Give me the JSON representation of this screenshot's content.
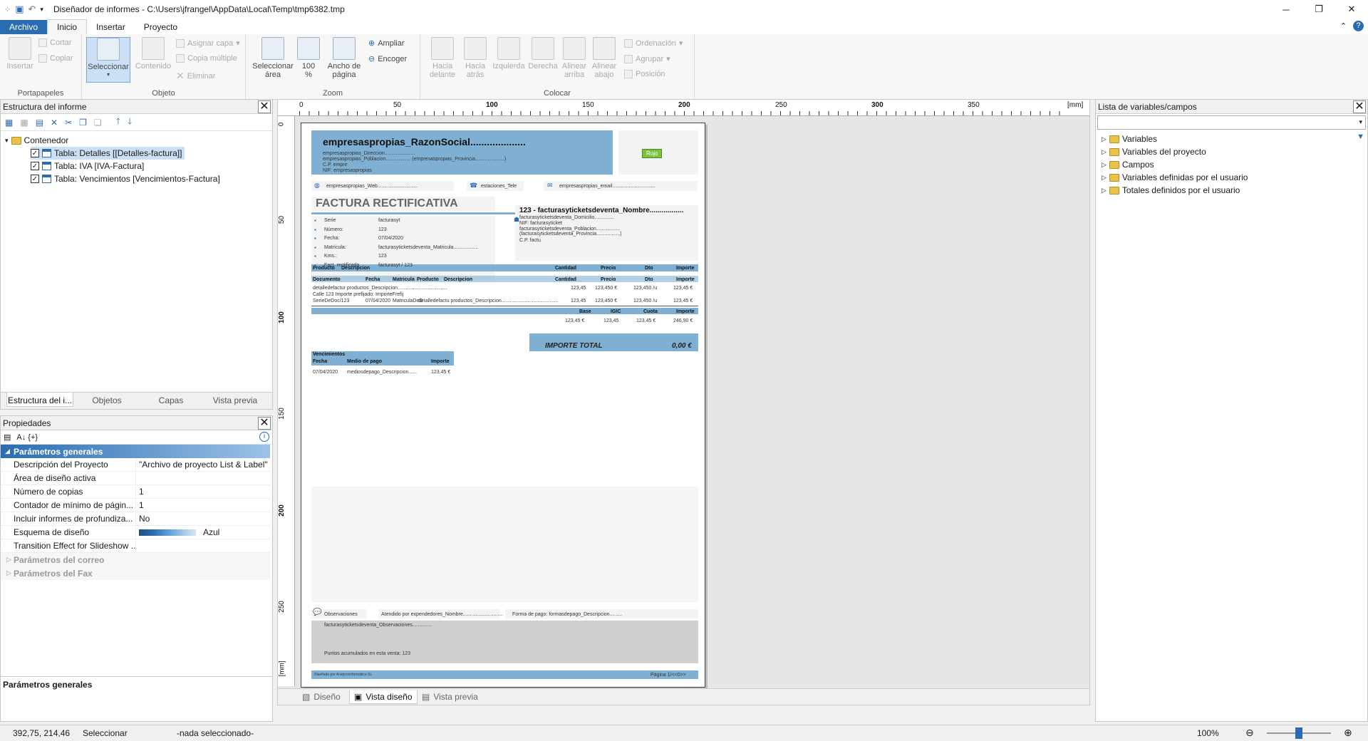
{
  "window": {
    "title": "Diseñador de informes - C:\\Users\\jfrangel\\AppData\\Local\\Temp\\tmp6382.tmp"
  },
  "ribbon_tabs": [
    "Archivo",
    "Inicio",
    "Insertar",
    "Proyecto"
  ],
  "ribbon": {
    "portapapeles": {
      "label": "Portapapeles",
      "insertar": "Insertar",
      "cortar": "Cortar",
      "copiar": "Copiar"
    },
    "objeto": {
      "label": "Objeto",
      "seleccionar": "Seleccionar",
      "contenido": "Contenido",
      "asignar_capa": "Asignar capa",
      "copia_multiple": "Copia múltiple",
      "eliminar": "Eliminar"
    },
    "zoom": {
      "label": "Zoom",
      "seleccionar_area_1": "Seleccionar",
      "seleccionar_area_2": "área",
      "pct_1": "100",
      "pct_2": "%",
      "ancho_1": "Ancho de",
      "ancho_2": "página",
      "ampliar": "Ampliar",
      "encoger": "Encoger"
    },
    "colocar": {
      "label": "Colocar",
      "hacia_delante_1": "Hacia",
      "hacia_delante_2": "delante",
      "hacia_atras_1": "Hacia",
      "hacia_atras_2": "atrás",
      "izquierda": "Izquierda",
      "derecha": "Derecha",
      "alinear_arriba_1": "Alinear",
      "alinear_arriba_2": "arriba",
      "alinear_abajo_1": "Alinear",
      "alinear_abajo_2": "abajo",
      "ordenacion": "Ordenación",
      "agrupar": "Agrupar",
      "posicion": "Posición"
    }
  },
  "structure_panel": {
    "title": "Estructura del informe",
    "root": "Contenedor",
    "items": [
      "Tabla: Detalles [[Detalles-factura]]",
      "Tabla: IVA [IVA-Factura]",
      "Tabla: Vencimientos [Vencimientos-Factura]"
    ],
    "tabs": [
      "Estructura del i...",
      "Objetos",
      "Capas",
      "Vista previa"
    ]
  },
  "properties_panel": {
    "title": "Propiedades",
    "sort_icons": "A↓ {+}",
    "category_active": "Parámetros generales",
    "rows": [
      {
        "k": "Descripción del Proyecto",
        "v": "\"Archivo de proyecto List & Label\""
      },
      {
        "k": "Área de diseño activa",
        "v": ""
      },
      {
        "k": "Número de copias",
        "v": "1"
      },
      {
        "k": "Contador de mínimo de págin...",
        "v": "1"
      },
      {
        "k": "Incluir informes de profundiza...",
        "v": "No"
      },
      {
        "k": "Esquema de diseño",
        "v": "Azul"
      },
      {
        "k": "Transition Effect for Slideshow ...",
        "v": ""
      }
    ],
    "category_mail": "Parámetros del correo",
    "category_fax": "Parámetros del Fax",
    "footer": "Parámetros generales"
  },
  "ruler": {
    "x_labels": [
      "0",
      "50",
      "100",
      "150",
      "200",
      "250",
      "300",
      "350"
    ],
    "unit": "[mm]",
    "y_labels": [
      "0",
      "50",
      "100",
      "150",
      "200",
      "250"
    ],
    "y_unit": "[mm]"
  },
  "report": {
    "company": "empresaspropias_RazonSocial....................",
    "addr1": "empresaspropias_Direccion......................",
    "addr2": "empresaspropias_Poblacion.................. (empresaspropias_Provincia.....................)",
    "cp": "C.P. empre",
    "nif": "NIF: empresaspropias",
    "logo": "Rojo",
    "web": "empresaspropias_Web.............................",
    "tele": "estaciones_Tele",
    "email": "empresaspropias_email...............................",
    "doc_title": "FACTURA RECTIFICATIVA",
    "fields": [
      {
        "k": "Serie",
        "v": "facturasyt"
      },
      {
        "k": "Número:",
        "v": "123"
      },
      {
        "k": "Fecha:",
        "v": "07/04/2020"
      },
      {
        "k": "Matrícula:",
        "v": "facturasyticketsdeventa_Matricula.................."
      },
      {
        "k": "Kms.:",
        "v": "123"
      },
      {
        "k": "Fact. rectificada",
        "v": "facturasyt / 123"
      }
    ],
    "client_name": "123 - facturasyticketsdeventa_Nombre.................",
    "client_lines": [
      "facturasyticketsdeventa_Domicilio..............",
      "NIF: facturasyticket",
      "facturasyticketsdeventa_Poblacion.................",
      "(facturasyticketsdeventa_Provincia.................)",
      "C.P. factu"
    ],
    "table1_head": [
      "Producto",
      "Descripcion",
      "Cantidad",
      "Precio",
      "Dto",
      "Importe"
    ],
    "table1_sub": [
      "Documento",
      "Fecha",
      "Matricula",
      "Producto",
      "Descripcion",
      "Cantidad",
      "Precio",
      "Dto",
      "Importe"
    ],
    "row1": [
      "detalledefactur productos_Descripcion....................................",
      "123,45",
      "123,450 €",
      "123,450 /u",
      "123,45 €"
    ],
    "row2": "Calle 123       Importe prefijado: ImporteFrefij",
    "row3": [
      "SerieDeDoc/123",
      "07/04/2020",
      "MatriculaDeD",
      "detalledefactu productos_Descripcion.........................................",
      "123,45",
      "123,450 €",
      "123,450 /u",
      "123,45 €"
    ],
    "iva_head": [
      "Base",
      "IGIC",
      "Cuota",
      "Importe"
    ],
    "iva_row": [
      "123,45 €",
      "123,45",
      "123,45 €",
      "246,90 €"
    ],
    "total_label": "IMPORTE TOTAL",
    "total_value": "0,00 €",
    "venc_title": "Vencimientos",
    "venc_head": [
      "Fecha",
      "Medio de pago",
      "Importe"
    ],
    "venc_row": [
      "07/04/2020",
      "mediosdepago_Descripcion......",
      "123,45 €"
    ],
    "obs_label": "Observaciones",
    "atendido": "Atendido por expendedores_Nombre.............................",
    "forma_pago": "Forma de pago: formasdepago_Descripcion.........",
    "obs_text": "facturasyticketsdeventa_Observaciones..............",
    "puntos": "Puntos acumulados en esta venta: 123",
    "footer_left": "Diseñado por Aceprocinformática SL",
    "footer_right": "Página 1/<<0>>"
  },
  "bottom_tabs": [
    "Diseño",
    "Vista diseño",
    "Vista previa"
  ],
  "variables_panel": {
    "title": "Lista de variables/campos",
    "items": [
      "Variables",
      "Variables del proyecto",
      "Campos",
      "Variables definidas por el usuario",
      "Totales definidos por el usuario"
    ]
  },
  "status": {
    "coords": "392,75, 214,46",
    "mode": "Seleccionar",
    "selection": "-nada seleccionado-",
    "zoom": "100%"
  },
  "colors": {
    "accent": "#2b6cb0",
    "report_blue": "#7fb0d4"
  }
}
